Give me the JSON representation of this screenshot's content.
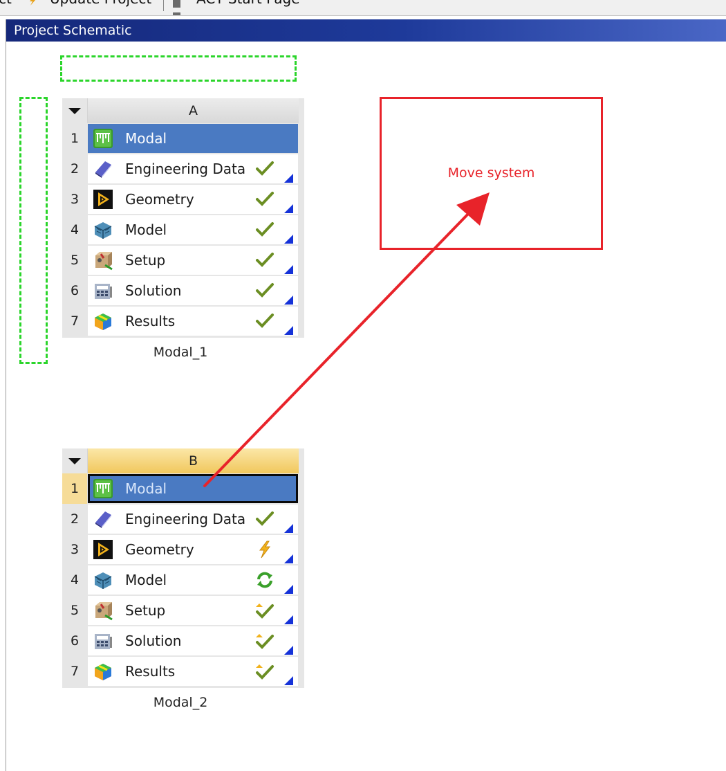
{
  "toolbar": {
    "left_fragment": "ct",
    "update_label": "Update Project",
    "start_page_label": "ACT Start Page"
  },
  "pane": {
    "title": "Project Schematic"
  },
  "systems": [
    {
      "letter": "A",
      "name": "Modal_1",
      "rows": [
        {
          "num": "1",
          "label": "Modal",
          "status": "none"
        },
        {
          "num": "2",
          "label": "Engineering Data",
          "status": "check"
        },
        {
          "num": "3",
          "label": "Geometry",
          "status": "check"
        },
        {
          "num": "4",
          "label": "Model",
          "status": "check"
        },
        {
          "num": "5",
          "label": "Setup",
          "status": "check"
        },
        {
          "num": "6",
          "label": "Solution",
          "status": "check"
        },
        {
          "num": "7",
          "label": "Results",
          "status": "check"
        }
      ]
    },
    {
      "letter": "B",
      "name": "Modal_2",
      "rows": [
        {
          "num": "1",
          "label": "Modal",
          "status": "none"
        },
        {
          "num": "2",
          "label": "Engineering Data",
          "status": "check"
        },
        {
          "num": "3",
          "label": "Geometry",
          "status": "lightning"
        },
        {
          "num": "4",
          "label": "Model",
          "status": "refresh"
        },
        {
          "num": "5",
          "label": "Setup",
          "status": "check-up"
        },
        {
          "num": "6",
          "label": "Solution",
          "status": "check-up"
        },
        {
          "num": "7",
          "label": "Results",
          "status": "check-up"
        }
      ]
    }
  ],
  "annotation": {
    "text": "Move system",
    "color": "#e8232a"
  },
  "colors": {
    "title_bar": "#15287a",
    "drop_zone": "#2bd52b",
    "selection": "#4a7ac2",
    "header_B": "#f1c75c"
  }
}
